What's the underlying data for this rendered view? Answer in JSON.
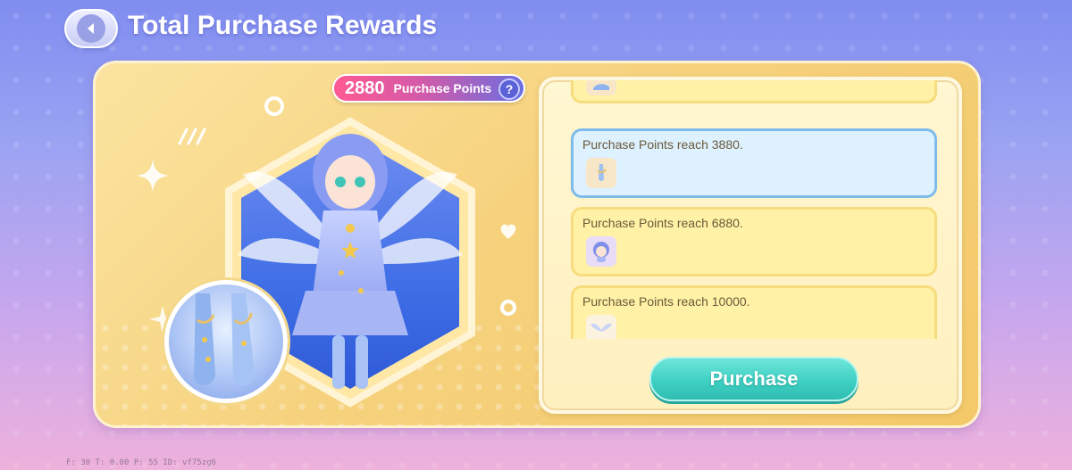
{
  "header": {
    "title": "Total Purchase Rewards"
  },
  "points": {
    "value": "2880",
    "label": "Purchase Points",
    "help_glyph": "?"
  },
  "rewards": {
    "items": [
      {
        "label": "",
        "icon": "blue-shoe-icon"
      },
      {
        "label": "Purchase Points reach 3880.",
        "icon": "ankle-jewelry-icon",
        "active": true
      },
      {
        "label": "Purchase Points reach 6880.",
        "icon": "character-portrait-icon"
      },
      {
        "label": "Purchase Points reach 10000.",
        "icon": "wing-accessory-icon"
      }
    ]
  },
  "actions": {
    "purchase_label": "Purchase"
  },
  "debug": {
    "text": "F: 30   T: 0.00   P: 55   ID: vf75zg6"
  },
  "colors": {
    "accent_teal": "#3fd0c3",
    "panel_gold": "#f6d27e",
    "active_row": "#def1ff",
    "badge_pink": "#ff5a92"
  }
}
